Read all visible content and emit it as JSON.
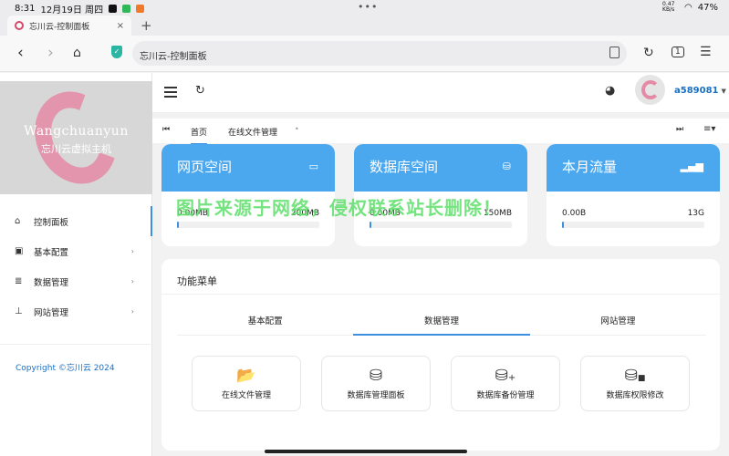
{
  "status": {
    "time": "8:31",
    "date": "12月19日 周四",
    "net": "0.47 KB/s",
    "battery": "47%"
  },
  "browser": {
    "tab_title": "忘川云-控制面板",
    "tab_close": "×",
    "new_tab": "+",
    "url": "忘川云-控制面板",
    "tab_count": "1"
  },
  "logo": {
    "line1": "Wangchuanyun",
    "line2": "忘川云虚拟主机"
  },
  "sidebar": {
    "items": [
      {
        "label": "控制面板",
        "icon": "home-icon"
      },
      {
        "label": "基本配置",
        "icon": "terminal-icon"
      },
      {
        "label": "数据管理",
        "icon": "list-icon"
      },
      {
        "label": "网站管理",
        "icon": "sitemap-icon"
      }
    ],
    "copyright": "Copyright ©忘川云 2024"
  },
  "header": {
    "username": "a589081"
  },
  "page_tabs": [
    {
      "label": "首页"
    },
    {
      "label": "在线文件管理"
    }
  ],
  "cards": [
    {
      "title": "网页空间",
      "used": "0.00MB",
      "total": "200MB",
      "progress": 0.0,
      "icon": "server-icon"
    },
    {
      "title": "数据库空间",
      "used": "0.00MB",
      "total": "150MB",
      "progress": 0.0,
      "icon": "database-icon"
    },
    {
      "title": "本月流量",
      "used": "0.00B",
      "total": "13G",
      "progress": 0.0,
      "icon": "signal-icon"
    }
  ],
  "watermark": "图片来源于网络，侵权联系站长删除！",
  "panel": {
    "title": "功能菜单",
    "tabs": [
      {
        "label": "基本配置"
      },
      {
        "label": "数据管理"
      },
      {
        "label": "网站管理"
      }
    ],
    "tiles": [
      {
        "label": "在线文件管理",
        "icon": "folder-open-icon"
      },
      {
        "label": "数据库管理面板",
        "icon": "database-icon"
      },
      {
        "label": "数据库备份管理",
        "icon": "database-plus-icon"
      },
      {
        "label": "数据库权限修改",
        "icon": "database-lock-icon"
      }
    ]
  },
  "colors": {
    "accent": "#3d8fe0",
    "card_header": "#4ba8ee",
    "link": "#1a6fc4",
    "watermark": "#5ee06a"
  }
}
